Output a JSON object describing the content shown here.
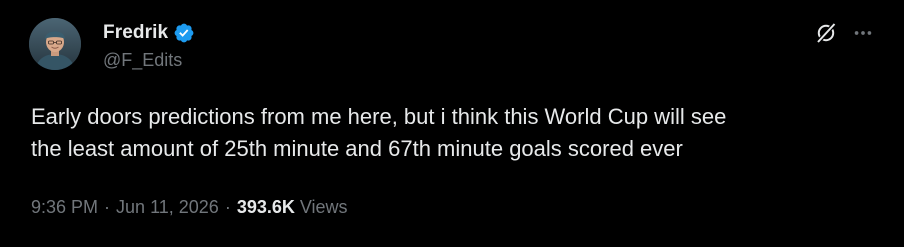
{
  "author": {
    "display_name": "Fredrik",
    "handle": "@F_Edits",
    "verified": true
  },
  "tweet": {
    "text_lines": [
      "Early doors predictions from me here, but i think this World Cup will see",
      "the least amount of 25th minute and 67th minute goals scored ever"
    ]
  },
  "meta": {
    "time": "9:36 PM",
    "separator": "·",
    "date": "Jun 11, 2026",
    "views_count": "393.6K",
    "views_label": "Views"
  },
  "icons": {
    "verified": "verified-badge-icon",
    "grok": "grok-icon",
    "more": "more-options-icon"
  },
  "colors": {
    "background": "#000000",
    "primary_text": "#e7e9ea",
    "secondary_text": "#71767b",
    "verified_blue": "#1d9bf0"
  }
}
